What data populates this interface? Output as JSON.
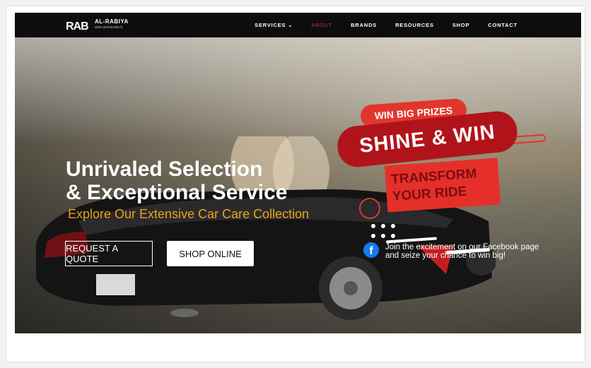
{
  "brand": {
    "mark": "RAB",
    "name": "AL-RABIYA",
    "tagline": "auto accesories tr."
  },
  "nav": {
    "items": [
      {
        "label": "SERVICES",
        "has_dropdown": true
      },
      {
        "label": "ABOUT",
        "active": true
      },
      {
        "label": "BRANDS"
      },
      {
        "label": "RESOURCES"
      },
      {
        "label": "SHOP"
      },
      {
        "label": "CONTACT"
      }
    ],
    "dropdown_icon": "chevron-down-icon",
    "active_color": "#d92f2f"
  },
  "hero": {
    "headline_line1": "Unrivaled Selection",
    "headline_line2": "& Exceptional Service",
    "subheadline": "Explore Our Extensive Car Care Collection",
    "subheadline_color": "#e8a31f",
    "cta_quote": "REQUEST A QUOTE",
    "cta_shop": "SHOP ONLINE"
  },
  "promo": {
    "badge": "WIN BIG PRIZES",
    "headline": "SHINE & WIN",
    "transform_line1": "TRANSFORM",
    "transform_line2": "YOUR RIDE",
    "facebook_icon": "facebook-icon",
    "facebook_text": "Join the excitement on our Facebook page and seize your chance to win big!",
    "red_primary": "#e1362d",
    "red_dark": "#b0141a"
  }
}
